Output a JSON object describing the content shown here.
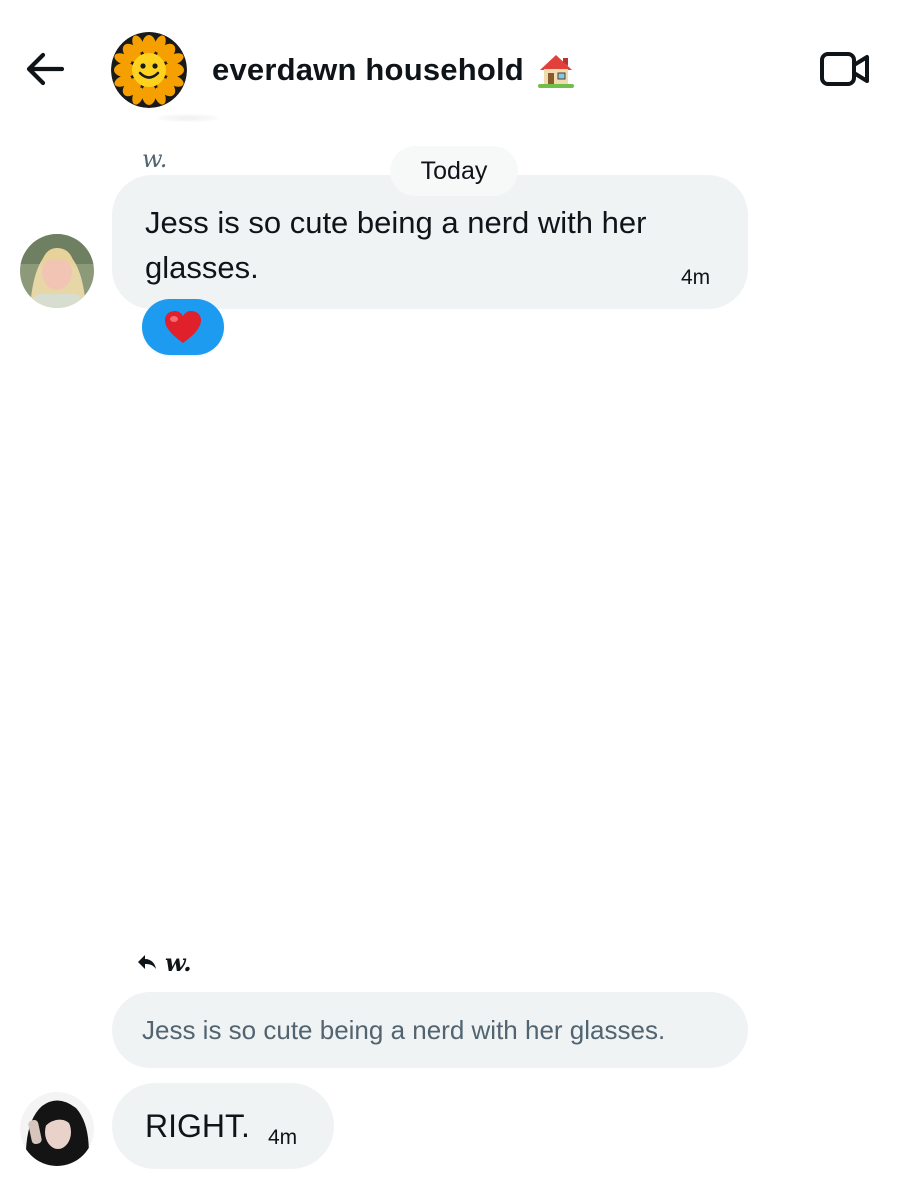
{
  "header": {
    "title": "everdawn household",
    "back_icon": "arrow-left-icon",
    "video_icon": "video-call-icon",
    "group_avatar_icon": "smiley-sunflower-icon",
    "title_emoji": "house-icon"
  },
  "conversation": {
    "date_divider": "Today",
    "messages": [
      {
        "sender": "w.",
        "text": "Jess is so cute being a nerd with her glasses.",
        "time": "4m",
        "reaction": "red-heart"
      },
      {
        "reply_to_sender": "w.",
        "quoted_text": "Jess is so cute being a nerd with her glasses.",
        "text": "RIGHT.",
        "time": "4m"
      }
    ]
  },
  "colors": {
    "bubble_bg": "#eff3f4",
    "reaction_bg": "#1d9bf0",
    "muted_text": "#536471",
    "primary_text": "#0f1419"
  }
}
